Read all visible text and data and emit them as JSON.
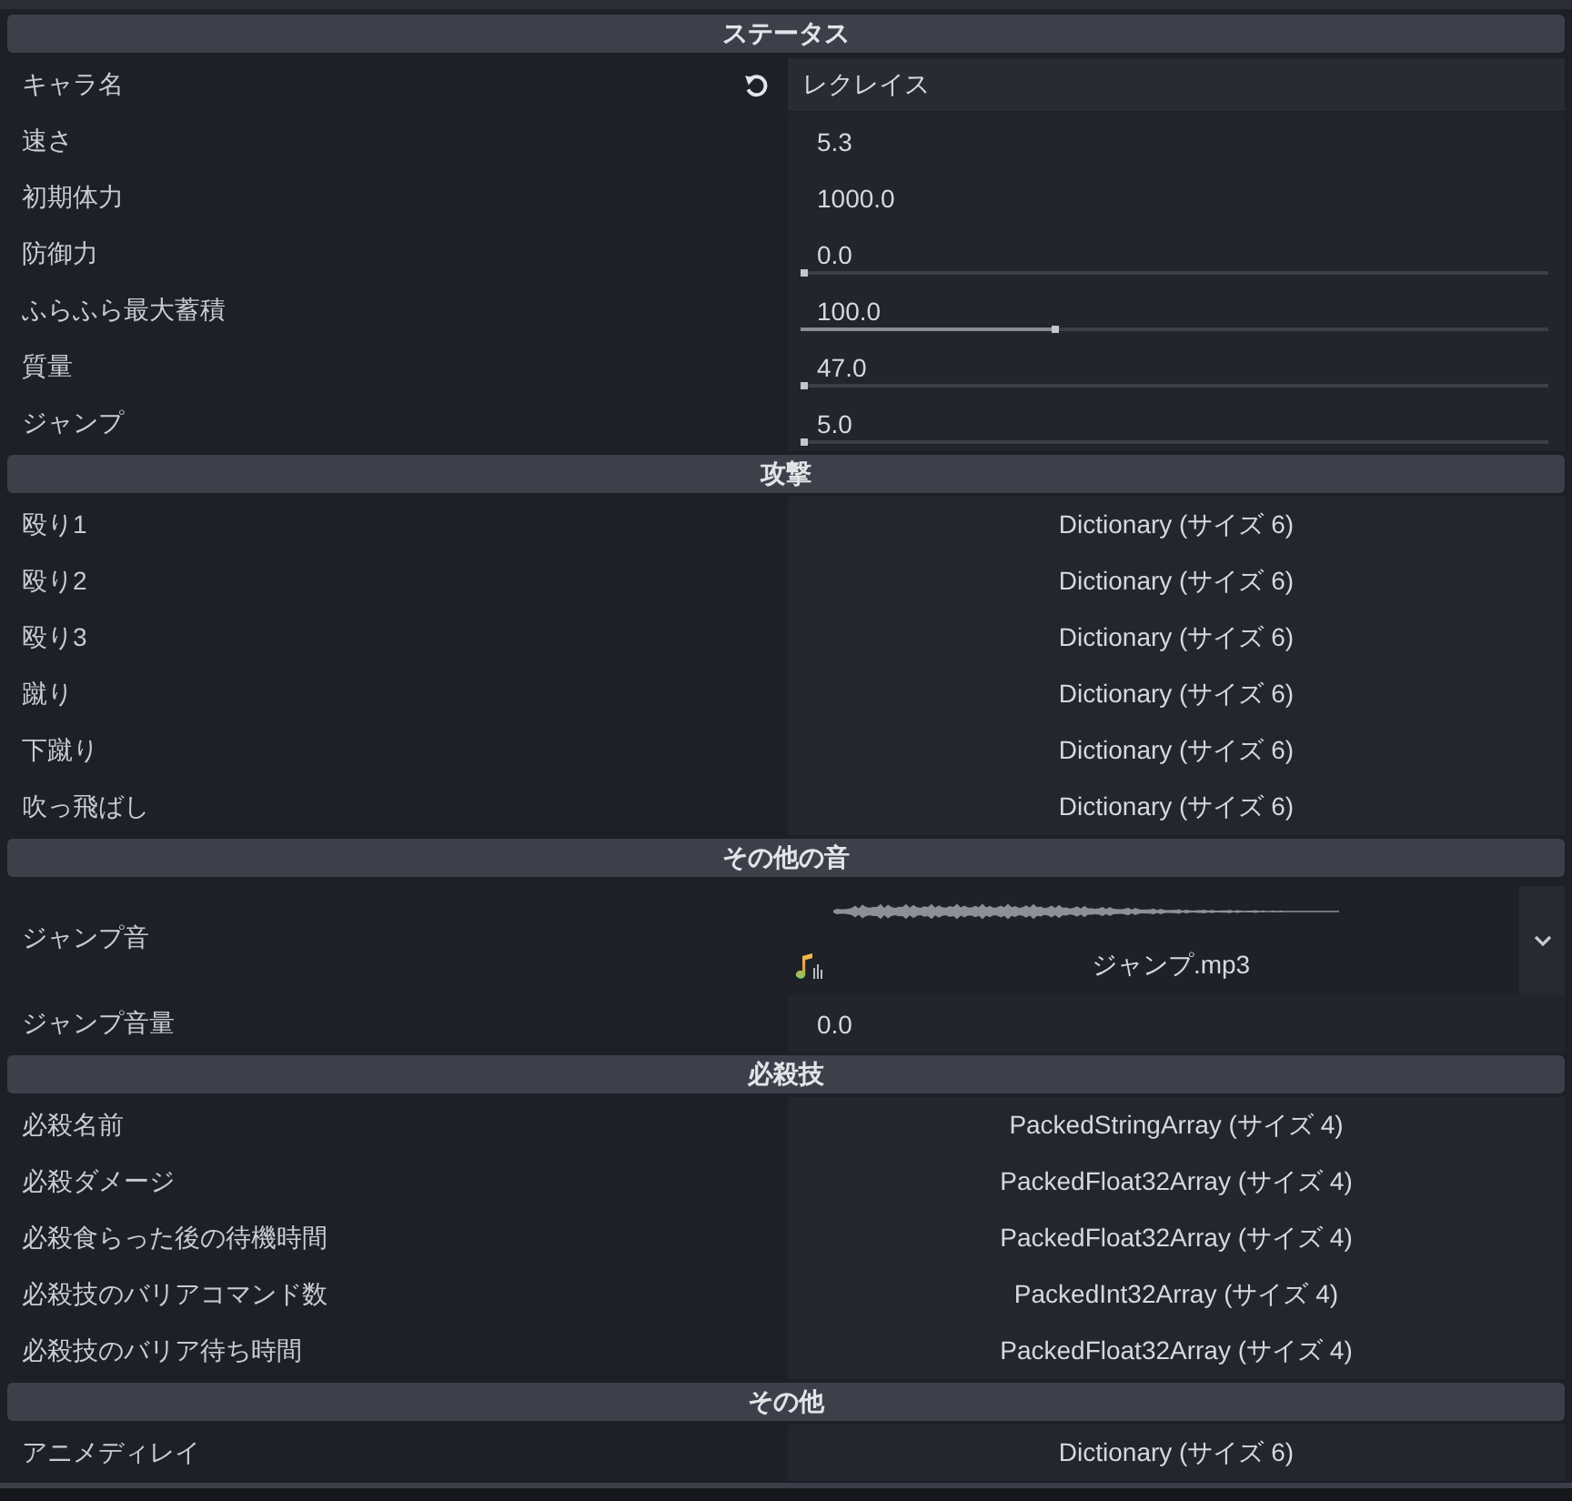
{
  "sections": [
    {
      "title": "ステータス",
      "properties": [
        {
          "kind": "text",
          "label": "キャラ名",
          "value": "レクレイス",
          "revertable": true
        },
        {
          "kind": "number",
          "label": "速さ",
          "value": "5.3",
          "revertable": false
        },
        {
          "kind": "number",
          "label": "初期体力",
          "value": "1000.0",
          "revertable": false
        },
        {
          "kind": "slider",
          "label": "防御力",
          "value": "0.0",
          "level": 0,
          "revertable": false
        },
        {
          "kind": "slider",
          "label": "ふらふら最大蓄積",
          "value": "100.0",
          "level": 0.34,
          "revertable": false
        },
        {
          "kind": "slider",
          "label": "質量",
          "value": "47.0",
          "level": 0,
          "revertable": false
        },
        {
          "kind": "slider",
          "label": "ジャンプ",
          "value": "5.0",
          "level": 0,
          "revertable": false
        }
      ]
    },
    {
      "title": "攻撃",
      "properties": [
        {
          "kind": "resource",
          "label": "殴り1",
          "value": "Dictionary (サイズ 6)",
          "revertable": false
        },
        {
          "kind": "resource",
          "label": "殴り2",
          "value": "Dictionary (サイズ 6)",
          "revertable": false
        },
        {
          "kind": "resource",
          "label": "殴り3",
          "value": "Dictionary (サイズ 6)",
          "revertable": false
        },
        {
          "kind": "resource",
          "label": "蹴り",
          "value": "Dictionary (サイズ 6)",
          "revertable": false
        },
        {
          "kind": "resource",
          "label": "下蹴り",
          "value": "Dictionary (サイズ 6)",
          "revertable": false
        },
        {
          "kind": "resource",
          "label": "吹っ飛ばし",
          "value": "Dictionary (サイズ 6)",
          "revertable": false
        }
      ]
    },
    {
      "title": "その他の音",
      "properties": [
        {
          "kind": "audio",
          "label": "ジャンプ音",
          "value": "ジャンプ.mp3",
          "revertable": false
        },
        {
          "kind": "number",
          "label": "ジャンプ音量",
          "value": "0.0",
          "revertable": false
        }
      ]
    },
    {
      "title": "必殺技",
      "properties": [
        {
          "kind": "resource",
          "label": "必殺名前",
          "value": "PackedStringArray (サイズ 4)",
          "revertable": false
        },
        {
          "kind": "resource",
          "label": "必殺ダメージ",
          "value": "PackedFloat32Array (サイズ 4)",
          "revertable": false
        },
        {
          "kind": "resource",
          "label": "必殺食らった後の待機時間",
          "value": "PackedFloat32Array (サイズ 4)",
          "revertable": false
        },
        {
          "kind": "resource",
          "label": "必殺技のバリアコマンド数",
          "value": "PackedInt32Array (サイズ 4)",
          "revertable": false
        },
        {
          "kind": "resource",
          "label": "必殺技のバリア待ち時間",
          "value": "PackedFloat32Array (サイズ 4)",
          "revertable": false
        }
      ]
    },
    {
      "title": "その他",
      "properties": [
        {
          "kind": "resource",
          "label": "アニメディレイ",
          "value": "Dictionary (サイズ 6)",
          "revertable": false
        }
      ]
    }
  ]
}
